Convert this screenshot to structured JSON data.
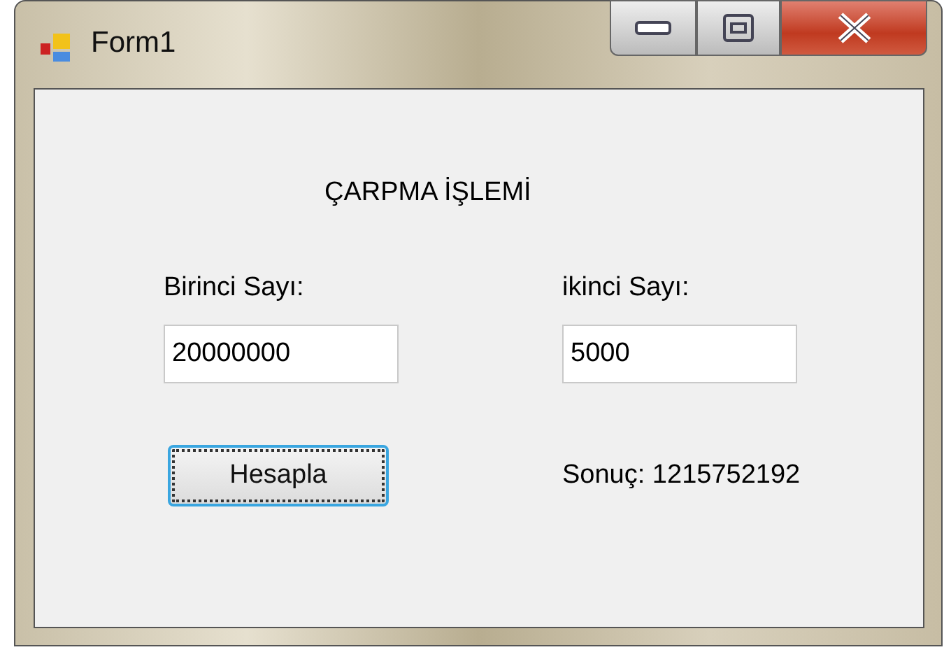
{
  "window": {
    "title": "Form1"
  },
  "heading": "ÇARPMA İŞLEMİ",
  "fields": [
    {
      "label": "Birinci Sayı:",
      "value": "20000000"
    },
    {
      "label": "ikinci Sayı:",
      "value": "5000"
    }
  ],
  "button": {
    "label": "Hesapla",
    "focused": true
  },
  "result": "Sonuç: 1215752192"
}
